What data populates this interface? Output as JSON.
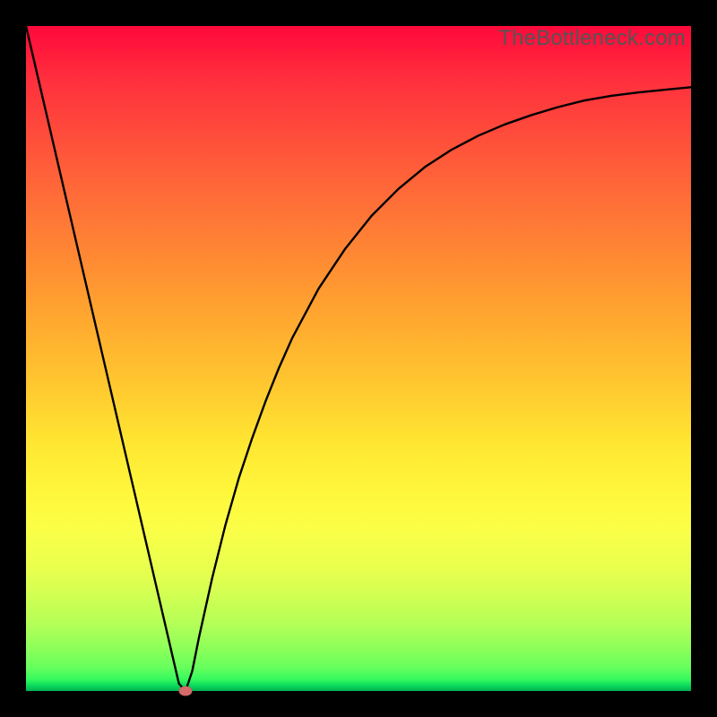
{
  "watermark": "TheBottleneck.com",
  "colors": {
    "background": "#000000",
    "curve": "#000000",
    "marker": "#d66a6a"
  },
  "chart_data": {
    "type": "line",
    "title": "",
    "xlabel": "",
    "ylabel": "",
    "xlim": [
      0,
      100
    ],
    "ylim": [
      0,
      100
    ],
    "x": [
      0,
      2,
      4,
      6,
      8,
      10,
      12,
      14,
      16,
      18,
      20,
      22,
      23,
      24,
      25,
      26,
      28,
      30,
      32,
      34,
      36,
      38,
      40,
      44,
      48,
      52,
      56,
      60,
      64,
      68,
      72,
      76,
      80,
      84,
      88,
      92,
      96,
      100
    ],
    "values": [
      100,
      91.4,
      82.8,
      74.2,
      65.6,
      57.0,
      48.4,
      39.8,
      31.2,
      22.6,
      14.0,
      5.4,
      1.1,
      0.0,
      3.0,
      8.0,
      17.0,
      25.0,
      32.0,
      38.0,
      43.5,
      48.5,
      53.0,
      60.5,
      66.5,
      71.5,
      75.5,
      78.8,
      81.4,
      83.5,
      85.2,
      86.6,
      87.8,
      88.8,
      89.5,
      90.0,
      90.4,
      90.8
    ],
    "marker": {
      "x": 24,
      "y": 0
    },
    "grid": false,
    "legend": false
  }
}
